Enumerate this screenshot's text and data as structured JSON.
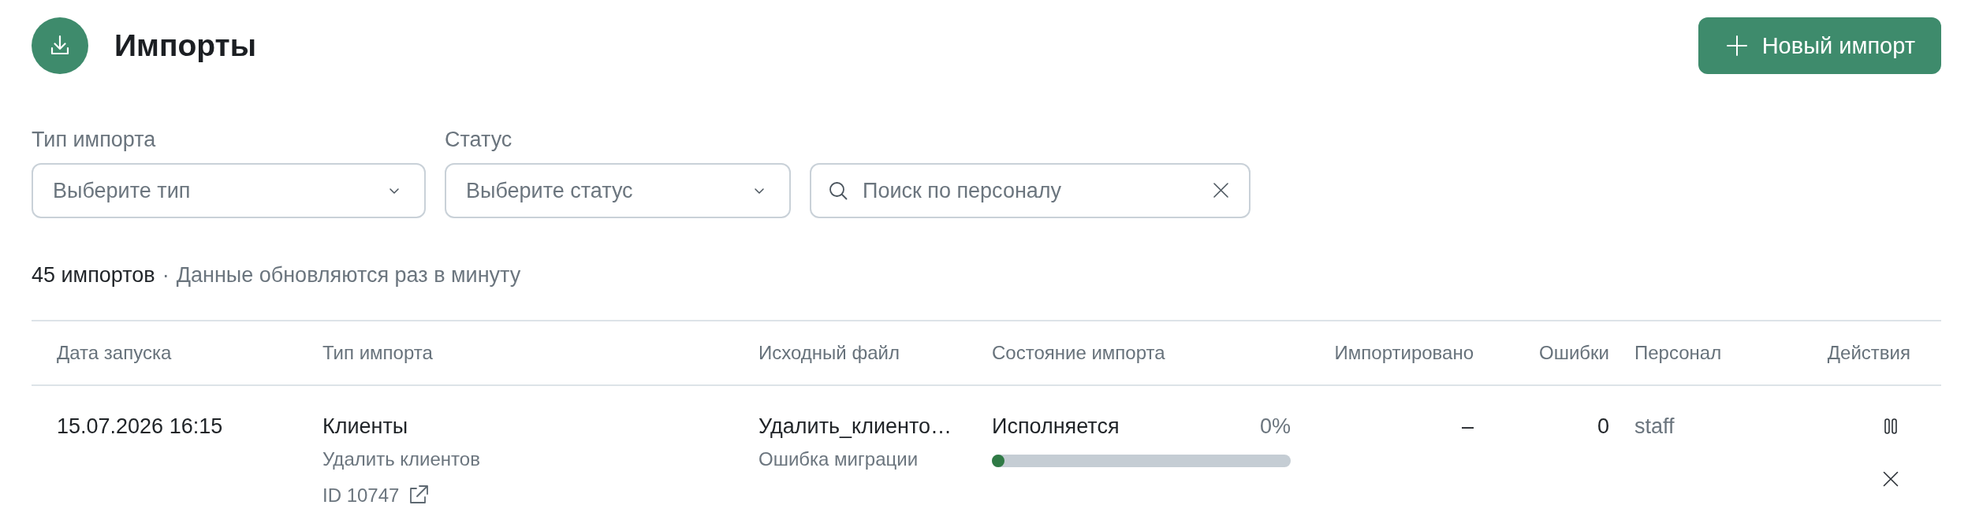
{
  "header": {
    "title": "Импорты",
    "new_button": {
      "label": "Новый импорт"
    }
  },
  "filters": [
    {
      "kind": "select",
      "label": "Тип импорта",
      "placeholder": "Выберите тип"
    },
    {
      "kind": "select",
      "label": "Статус",
      "placeholder": "Выберите статус"
    },
    {
      "kind": "search",
      "placeholder": "Поиск по персоналу"
    }
  ],
  "summary": {
    "count": "45 импортов",
    "separator": "·",
    "note": "Данные обновляются раз в минуту"
  },
  "table": {
    "columns": [
      "Дата запуска",
      "Тип импорта",
      "Исходный файл",
      "Состояние импорта",
      "Импортировано",
      "Ошибки",
      "Персонал",
      "Действия"
    ],
    "rows": [
      {
        "started": "15.07.2026 16:15",
        "type": "Клиенты",
        "action": "Удалить клиентов",
        "id": "ID 10747",
        "file": "Удалить_клиенто…",
        "file_note": "Ошибка миграции",
        "state": "Исполняется",
        "percent": "0%",
        "level": 0,
        "imported": "–",
        "errors": "0",
        "staff": "staff",
        "actions": [
          {
            "kind": "pause"
          },
          {
            "kind": "cancel"
          }
        ]
      }
    ]
  }
}
